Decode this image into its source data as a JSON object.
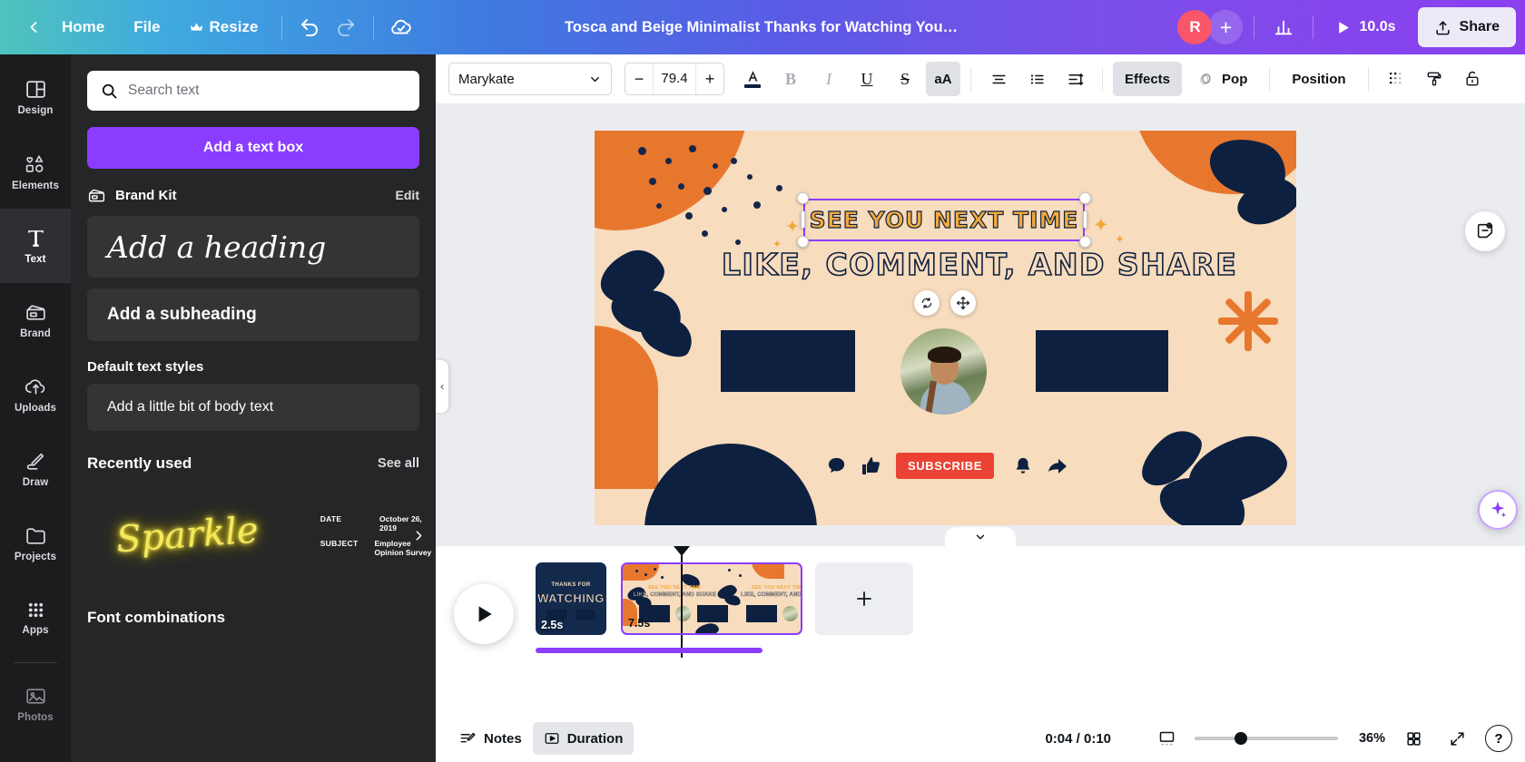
{
  "topbar": {
    "back_icon": "chevron-left-icon",
    "home": "Home",
    "file": "File",
    "resize": "Resize",
    "resize_icon": "crown-icon",
    "undo_icon": "undo-icon",
    "redo_icon": "redo-icon",
    "cloud_icon": "cloud-check-icon",
    "design_title": "Tosca and Beige Minimalist Thanks for Watching YouTube O..",
    "avatar_initial": "R",
    "add_collaborator": "+",
    "insights_icon": "bar-chart-icon",
    "play_icon": "play-icon",
    "duration": "10.0s",
    "share_label": "Share",
    "share_icon": "upload-icon"
  },
  "rail": {
    "items": [
      {
        "label": "Design",
        "icon": "layout-icon",
        "active": false
      },
      {
        "label": "Elements",
        "icon": "shapes-icon",
        "active": false
      },
      {
        "label": "Text",
        "icon": "text-t-icon",
        "active": true
      },
      {
        "label": "Brand",
        "icon": "brand-kit-icon",
        "active": false
      },
      {
        "label": "Uploads",
        "icon": "cloud-upload-icon",
        "active": false
      },
      {
        "label": "Draw",
        "icon": "pen-icon",
        "active": false
      },
      {
        "label": "Projects",
        "icon": "folder-icon",
        "active": false
      },
      {
        "label": "Apps",
        "icon": "grid-dots-icon",
        "active": false
      },
      {
        "label": "Photos",
        "icon": "photo-icon",
        "active": false
      }
    ]
  },
  "panel": {
    "search_placeholder": "Search text",
    "search_value": "",
    "search_icon": "search-icon",
    "add_text_box": "Add a text box",
    "brand_kit_label": "Brand Kit",
    "brand_kit_icon": "brand-kit-icon",
    "edit_label": "Edit",
    "heading_card": "Add a heading",
    "subheading_card": "Add a subheading",
    "default_styles_label": "Default text styles",
    "body_card": "Add a little bit of body text",
    "recently_used_label": "Recently used",
    "see_all_label": "See all",
    "recent_sparkle": "Sparkle",
    "recent_survey": {
      "date_label": "DATE",
      "date_value": "October 26, 2019",
      "subject_label": "SUBJECT",
      "subject_value": "Employee Opinion Survey"
    },
    "next_arrow_icon": "chevron-right-icon",
    "font_combinations_label": "Font combinations",
    "collapse_icon": "chevron-left-icon"
  },
  "toolbar": {
    "font_family": "Marykate",
    "font_chevron_icon": "chevron-down-icon",
    "font_size_minus": "−",
    "font_size": "79.4",
    "font_size_plus": "+",
    "text_color_icon": "text-color-icon",
    "bold_label": "B",
    "italic_label": "I",
    "underline_label": "U",
    "strikethrough_label": "S",
    "case_label": "aA",
    "align_icon": "align-icon",
    "list_icon": "bullet-list-icon",
    "spacing_icon": "line-spacing-icon",
    "effects_label": "Effects",
    "animate_label": "Pop",
    "animate_icon": "animate-icon",
    "position_label": "Position",
    "transparency_icon": "transparency-icon",
    "paint_icon": "paint-roller-icon",
    "lock_icon": "lock-icon",
    "accent_color": "#8b3dff"
  },
  "canvas": {
    "headline": "SEE YOU NEXT TIME",
    "subline": "LIKE, COMMENT, AND SHARE",
    "subscribe_label": "SUBSCRIBE",
    "comment_icon": "comment-icon",
    "like_icon": "thumbs-up-icon",
    "bell_icon": "bell-icon",
    "share_icon": "share-arrow-icon",
    "rotate_icon": "rotate-icon",
    "move_icon": "move-icon",
    "sticker_icon": "sticker-smile-icon",
    "magic_icon": "magic-sparkle-icon",
    "expand_tab_icon": "chevron-down-icon",
    "bg_color": "#f7dcbd",
    "navy_color": "#0d2040",
    "orange_color": "#e8772e",
    "headline_color": "#f2a93b",
    "subscribe_color": "#ea4335"
  },
  "timeline": {
    "play_icon": "play-icon",
    "scenes": [
      {
        "duration": "2.5s",
        "title_small": "THANKS FOR",
        "title_big": "WATCHING",
        "selected": false
      },
      {
        "duration": "7.5s",
        "mini_head": "SEE YOU NEXT TIME",
        "mini_sub": "LIKE, COMMENT, AND SHARE",
        "selected": true
      }
    ],
    "add_page_icon": "plus-icon"
  },
  "bottombar": {
    "notes_label": "Notes",
    "notes_icon": "notes-icon",
    "duration_label": "Duration",
    "duration_icon": "duration-icon",
    "time_current": "0:04",
    "time_separator": "/",
    "time_total": "0:10",
    "time_display": "0:04 / 0:10",
    "pages_icon": "page-view-icon",
    "zoom_percent": "36%",
    "grid_icon": "grid-view-icon",
    "fullscreen_icon": "expand-icon",
    "help_label": "?"
  }
}
